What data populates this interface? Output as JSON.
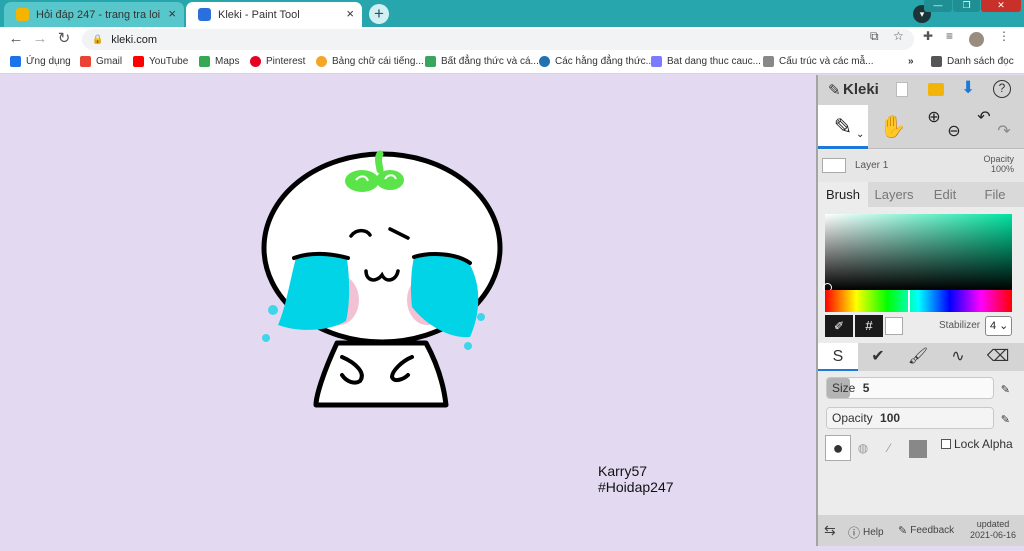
{
  "browser": {
    "tabs": [
      {
        "title": "Hỏi đáp 247 - trang tra loi",
        "favicon_color": "#f5b400"
      },
      {
        "title": "Kleki - Paint Tool",
        "favicon_color": "#2a6fdb"
      }
    ],
    "newtab_label": "+",
    "close_label": "×",
    "url": "kleki.com",
    "window_controls": [
      "—",
      "❐",
      "✕"
    ]
  },
  "bookmarks": {
    "items": [
      {
        "label": "Ứng dụng",
        "color": "#1a73e8"
      },
      {
        "label": "Gmail",
        "color": "#ea4335"
      },
      {
        "label": "YouTube",
        "color": "#ff0000"
      },
      {
        "label": "Maps",
        "color": "#34a853"
      },
      {
        "label": "Pinterest",
        "color": "#e60023"
      },
      {
        "label": "Bảng chữ cái tiếng...",
        "color": "#f5a623"
      },
      {
        "label": "Bất đẳng thức và cá...",
        "color": "#3aa55d"
      },
      {
        "label": "Các hằng đẳng thức...",
        "color": "#2271b1"
      },
      {
        "label": "Bat dang thuc cauc...",
        "color": "#7b7bff"
      },
      {
        "label": "Cấu trúc và các mẫ...",
        "color": "#888888"
      }
    ],
    "more": "»",
    "reading_list": "Danh sách đọc"
  },
  "kleki": {
    "app_name": "Kleki",
    "layer": {
      "name": "Layer 1",
      "opacity_label": "Opacity",
      "opacity_value": "100%"
    },
    "tabs": [
      "Brush",
      "Layers",
      "Edit",
      "File"
    ],
    "hex_symbol": "#",
    "stabilizer_label": "Stabilizer",
    "stabilizer_value": "4",
    "size_label": "Size",
    "size_value": "5",
    "size_fraction": 0.14,
    "opacity_label": "Opacity",
    "opacity_value": "100",
    "opacity_fraction": 1.0,
    "lock_alpha_label": "Lock Alpha",
    "help_label": "Help",
    "feedback_label": "Feedback",
    "updated_label": "updated",
    "updated_date": "2021-06-16",
    "colors": {
      "primary": "#000000",
      "secondary": "#ffffff",
      "picker_hue": "#00e2a0"
    }
  },
  "canvas": {
    "watermark_line1": "Karry57",
    "watermark_line2": "#Hoidap247",
    "colors": {
      "background": "#e3daf2",
      "tears": "#00d4e6",
      "sprout": "#5be34a",
      "blush": "#f2c1d3"
    }
  }
}
